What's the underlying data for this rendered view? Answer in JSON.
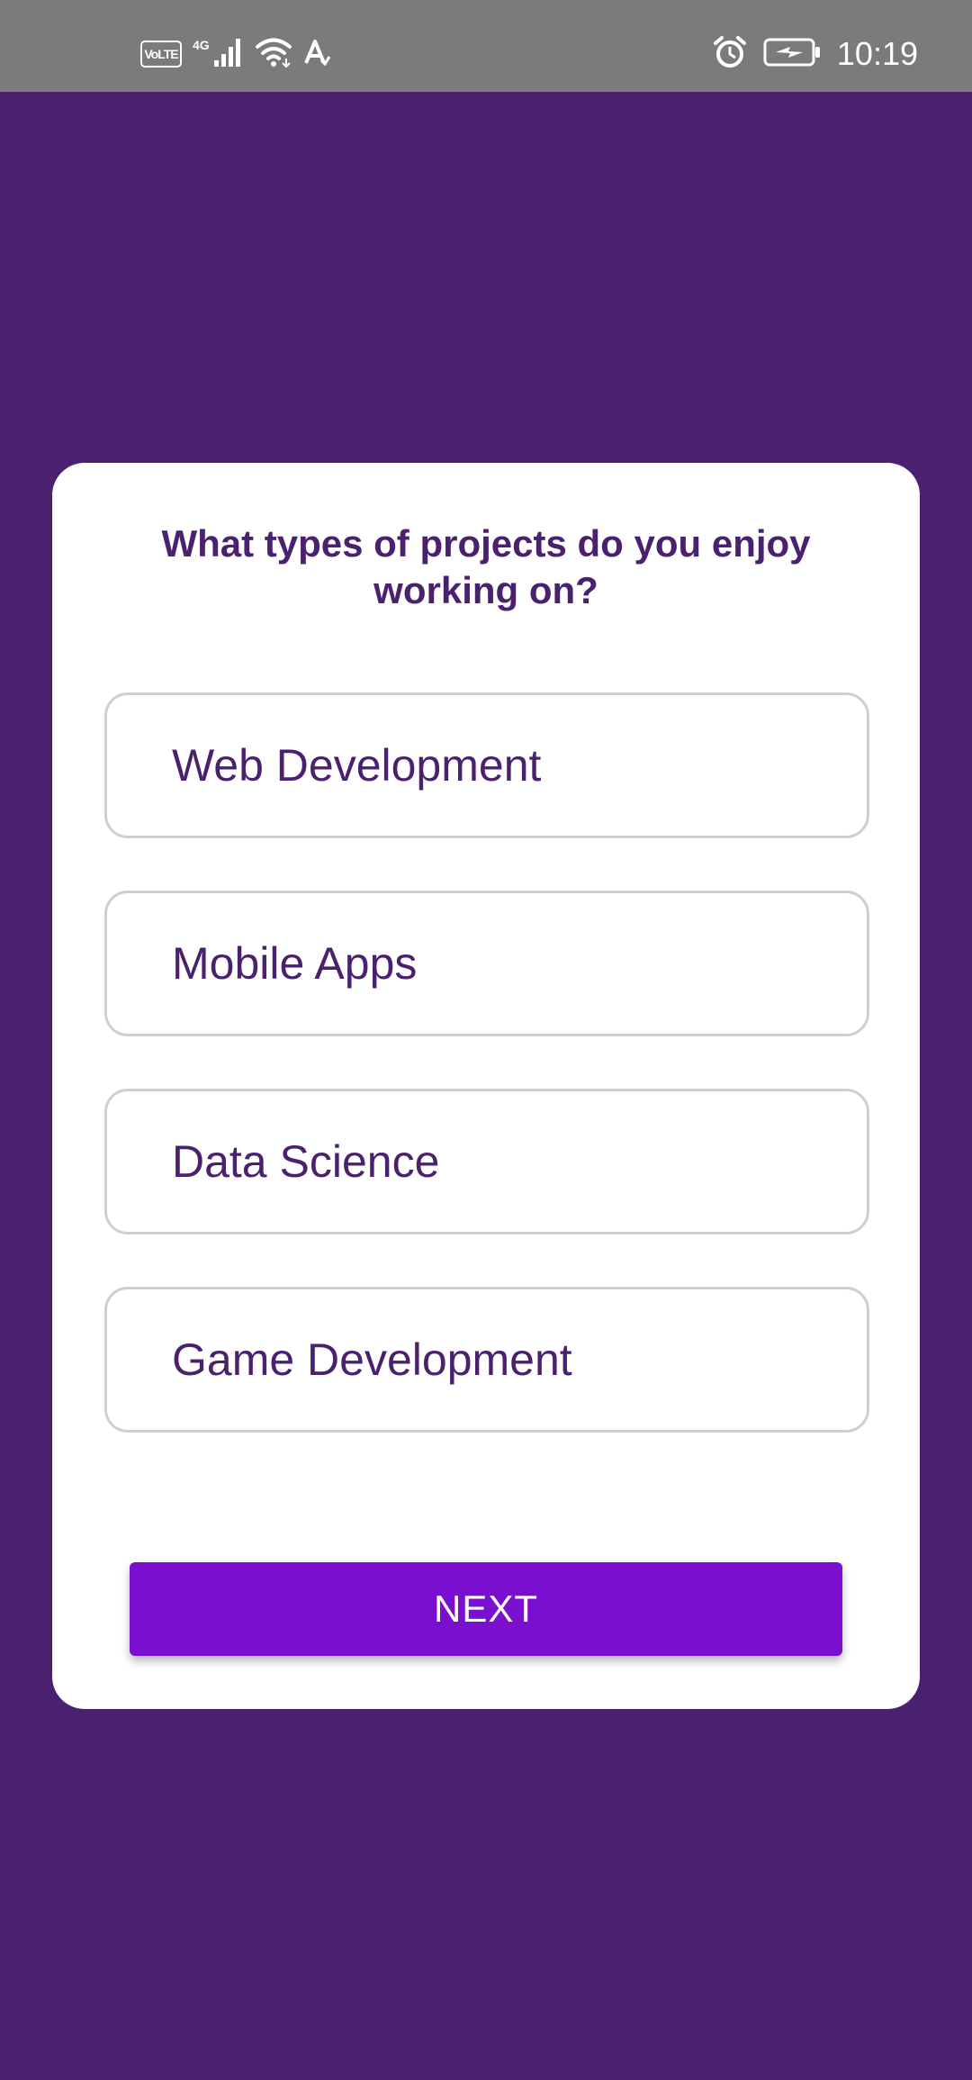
{
  "status_bar": {
    "volte": "VoLTE",
    "network_type": "4G",
    "time": "10:19",
    "icons": [
      "volte-icon",
      "signal-icon",
      "wifi-icon",
      "data-saver-icon",
      "alarm-icon",
      "battery-charging-icon"
    ],
    "background": "#7b7b7b"
  },
  "quiz": {
    "question": "What types of projects do you enjoy working on?",
    "options": [
      {
        "label": "Web Development"
      },
      {
        "label": "Mobile Apps"
      },
      {
        "label": "Data Science"
      },
      {
        "label": "Game Development"
      }
    ],
    "next_label": "NEXT"
  },
  "colors": {
    "background": "#4a216f",
    "card": "#ffffff",
    "text": "#4a216f",
    "option_border": "#cfcfcf",
    "button": "#7a0fcf",
    "button_text": "#ffffff"
  }
}
